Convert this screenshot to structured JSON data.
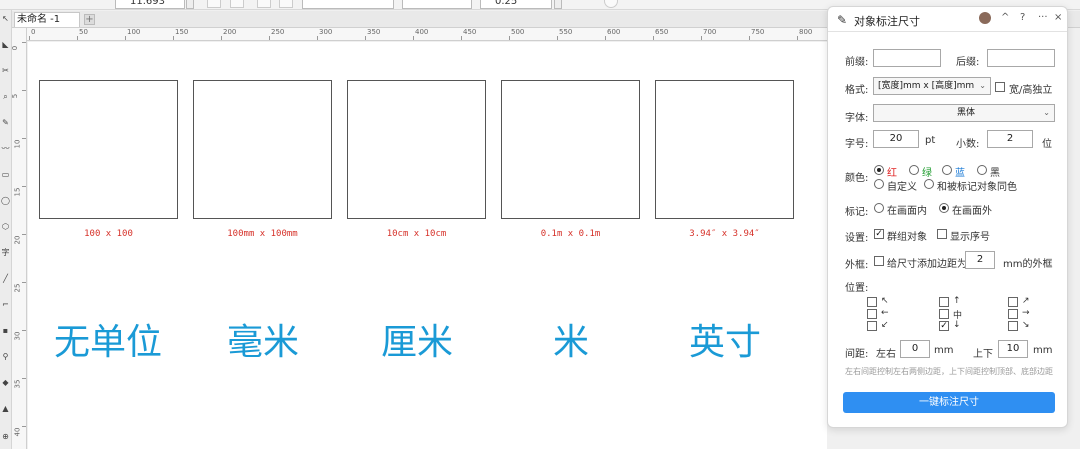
{
  "toolbar": {
    "size_value": "11.693 \"",
    "field2_value": "",
    "field3_value": "",
    "outline_value": "0.25 \""
  },
  "tabs": {
    "doc_tab": "未命名 -1",
    "add": "+"
  },
  "ruler_top": [
    "0",
    "50",
    "100",
    "150",
    "200",
    "250",
    "300",
    "350",
    "400",
    "450",
    "500",
    "550",
    "600",
    "650",
    "700",
    "750",
    "800"
  ],
  "ruler_left": [
    "0",
    "5",
    "10",
    "15",
    "20",
    "25",
    "30",
    "35",
    "40"
  ],
  "canvas": {
    "boxes": [
      {
        "dim": "100 x 100",
        "big": "无单位"
      },
      {
        "dim": "100mm x 100mm",
        "big": "毫米"
      },
      {
        "dim": "10cm x 10cm",
        "big": "厘米"
      },
      {
        "dim": "0.1m x 0.1m",
        "big": "米"
      },
      {
        "dim": "3.94″ x 3.94″",
        "big": "英寸"
      }
    ]
  },
  "panel": {
    "title": "对象标注尺寸",
    "header_buttons": {
      "collapse": "^",
      "help": "?",
      "more": "···",
      "close": "×"
    },
    "prefix_label": "前缀:",
    "suffix_label": "后缀:",
    "format_label": "格式:",
    "format_value": "[宽度]mm x [高度]mm",
    "independent_label": "宽/高独立",
    "font_label": "字体:",
    "font_value": "黑体",
    "size_label": "字号:",
    "size_value": "20",
    "size_unit": "pt",
    "decimal_label": "小数:",
    "decimal_value": "2",
    "decimal_unit": "位",
    "color_label": "颜色:",
    "colors": {
      "red": "红",
      "green": "绿",
      "blue": "蓝",
      "black": "黑",
      "custom": "自定义",
      "same": "和被标记对象同色"
    },
    "color_values": {
      "red": "#e02020",
      "green": "#1a9a2a",
      "blue": "#1a7ad6"
    },
    "mark_label": "标记:",
    "mark_inside": "在画面内",
    "mark_outside": "在画面外",
    "settings_label": "设置:",
    "group_label": "群组对象",
    "seq_label": "显示序号",
    "frame_label": "外框:",
    "frame_text": "给尺寸添加边距为",
    "frame_value": "2",
    "frame_unit": "mm的外框",
    "position_label": "位置:",
    "positions": [
      "↖",
      "↑",
      "↗",
      "←",
      "中",
      "→",
      "↙",
      "↓",
      "↘"
    ],
    "spacing_label": "间距:",
    "lr_label": "左右",
    "lr_value": "0",
    "lr_unit": "mm",
    "tb_label": "上下",
    "tb_value": "10",
    "tb_unit": "mm",
    "hint": "左右间距控制左右两侧边距，上下间距控制顶部、底部边距",
    "action": "一键标注尺寸"
  }
}
